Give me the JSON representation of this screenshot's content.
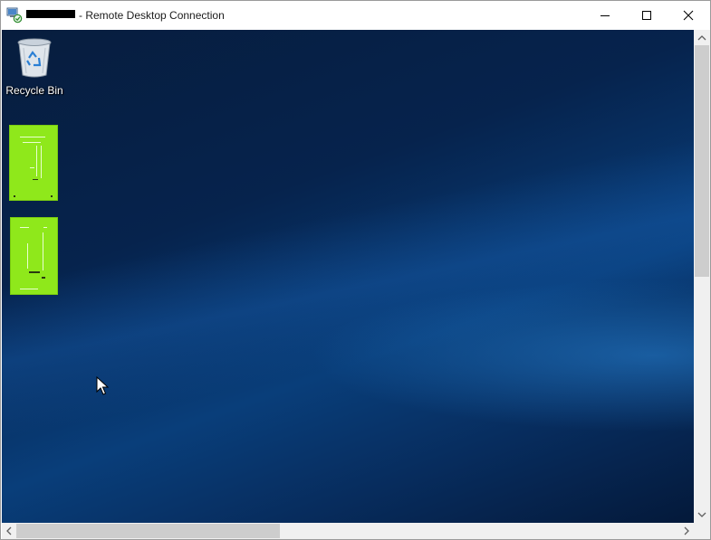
{
  "window": {
    "title_suffix": "- Remote Desktop Connection",
    "controls": {
      "minimize": "minimize",
      "maximize": "maximize",
      "close": "close"
    }
  },
  "desktop": {
    "icons": [
      {
        "label": "Recycle Bin",
        "icon": "recycle-bin-icon"
      },
      {
        "label": "",
        "icon": "document-thumbnail-icon"
      },
      {
        "label": "",
        "icon": "document-thumbnail-icon"
      }
    ]
  },
  "colors": {
    "thumbnail_green": "#8fe81b",
    "scrollbar_track": "#f0f0f0",
    "scrollbar_thumb": "#cdcdcd"
  }
}
